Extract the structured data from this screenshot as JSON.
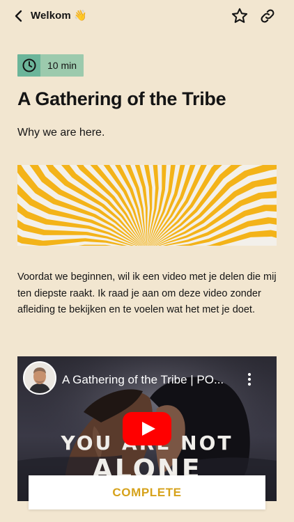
{
  "header": {
    "title": "Welkom 👋",
    "back_icon": "chevron-left-icon",
    "bookmark_icon": "star-outline-icon",
    "share_icon": "link-icon"
  },
  "lesson": {
    "duration": "10 min",
    "title": "A Gathering of the Tribe",
    "subtitle": "Why we are here.",
    "body": "Voordat we beginnen, wil ik een video met je delen die mij ten diepste raakt. Ik raad je aan om deze video zonder afleiding te bekijken en te voelen wat het met je doet."
  },
  "video": {
    "title": "A Gathering of the Tribe | PO...",
    "overlay_line1": "YOU ARE NOT",
    "overlay_line2": "ALONE"
  },
  "actions": {
    "complete_label": "COMPLETE"
  },
  "colors": {
    "background": "#f2e6d0",
    "duration_icon_bg": "#6cb59a",
    "duration_text_bg": "#9ccaad",
    "banner_orange": "#f3b319",
    "complete_text": "#d6a21a",
    "youtube_red": "#ff0000"
  }
}
